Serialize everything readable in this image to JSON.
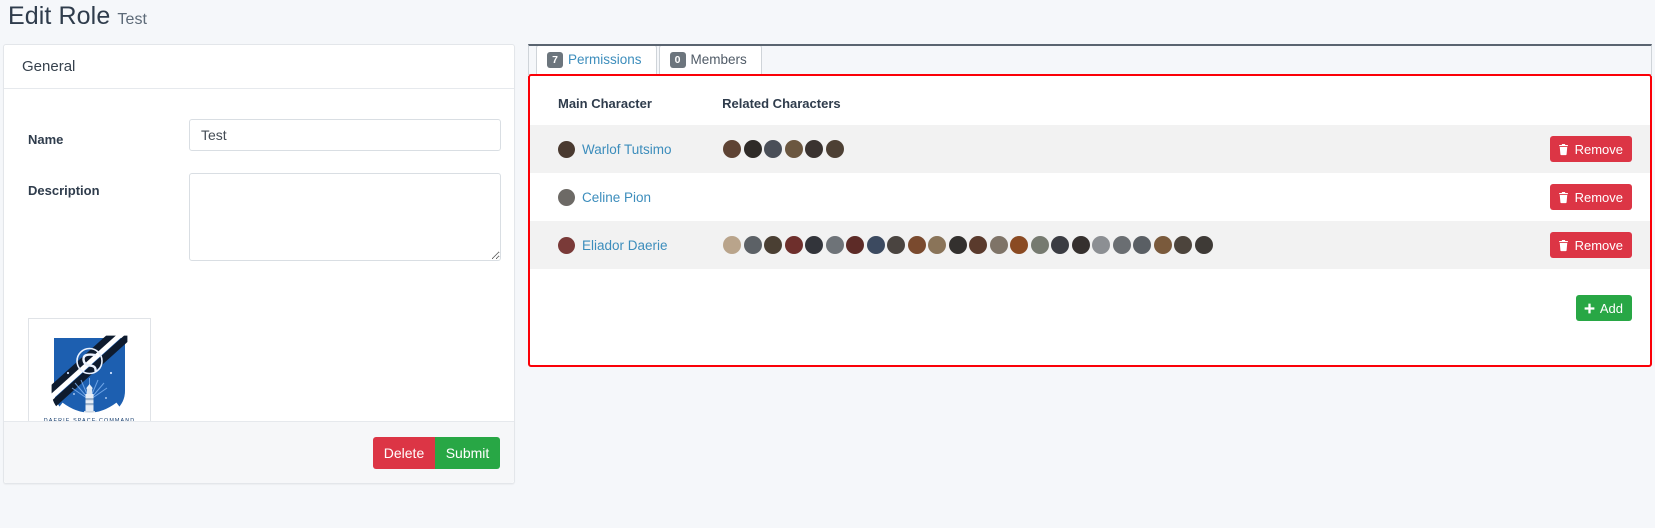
{
  "header": {
    "title": "Edit Role",
    "subtitle": "Test"
  },
  "general_card": {
    "heading": "General",
    "name_label": "Name",
    "name_value": "Test",
    "name_placeholder": "",
    "description_label": "Description",
    "description_value": "",
    "description_placeholder": "",
    "logo_alt": "Daerie Space Command crest",
    "logo_text": "DAERIE SPACE COMMAND",
    "delete_label": "Delete",
    "submit_label": "Submit"
  },
  "tabs": [
    {
      "label": "Permissions",
      "badge": "7",
      "active": true
    },
    {
      "label": "Members",
      "badge": "0",
      "active": false
    }
  ],
  "permissions_table": {
    "columns": [
      "Main Character",
      "Related Characters"
    ],
    "remove_label": "Remove",
    "add_label": "Add",
    "rows": [
      {
        "main_character": "Warlof Tutsimo",
        "main_avatar": "#4a3a30",
        "related_count": 6,
        "related_avatars": [
          "#5e4334",
          "#2f2b28",
          "#4a4f58",
          "#6b5740",
          "#3a3330",
          "#4d4034"
        ]
      },
      {
        "main_character": "Celine Pion",
        "main_avatar": "#6d6a66",
        "related_count": 0,
        "related_avatars": []
      },
      {
        "main_character": "Eliador Daerie",
        "main_avatar": "#7a3a38",
        "related_count": 24,
        "related_avatars": [
          "#b9a48b",
          "#5c6166",
          "#4a3f33",
          "#6e2f2c",
          "#32343a",
          "#6e7378",
          "#5d2b27",
          "#3c4a60",
          "#4a4440",
          "#7a4a2e",
          "#8a7459",
          "#33302e",
          "#5a3a2c",
          "#7f7468",
          "#8a4a22",
          "#767a70",
          "#3a3c42",
          "#35302e",
          "#8c8f93",
          "#6a6e72",
          "#5a5f64",
          "#7a5a3c",
          "#4c443c",
          "#3e3a36"
        ]
      }
    ]
  },
  "colors": {
    "accent_blue": "#3c8dbc",
    "danger_red": "#dc3545",
    "success_green": "#28a745",
    "highlight_outline": "#fb0007",
    "badge_grey": "#6c757d"
  }
}
